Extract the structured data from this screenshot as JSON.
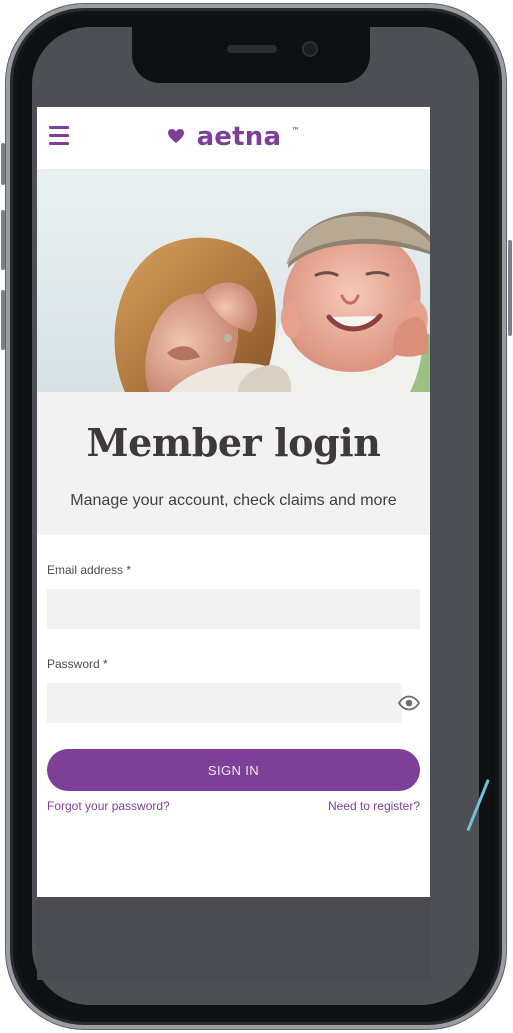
{
  "app": {
    "brand": "aetna",
    "brand_mark": "™",
    "menu_icon": "hamburger-menu-icon"
  },
  "hero": {
    "image": "couple-kiss-photo"
  },
  "intro": {
    "title": "Member login",
    "subtitle": "Manage your account, check claims and more"
  },
  "form": {
    "email_label": "Email address *",
    "email_value": "",
    "email_placeholder": "",
    "password_label": "Password *",
    "password_value": "",
    "password_placeholder": "",
    "password_toggle_icon": "eye-icon",
    "sign_in_label": "SIGN IN",
    "forgot_password_label": "Forgot your password?",
    "register_label": "Need to register?"
  },
  "colors": {
    "brand_purple": "#7d3f98",
    "panel_gray": "#f2f2f2",
    "accent_teal": "#6fc0d4"
  }
}
